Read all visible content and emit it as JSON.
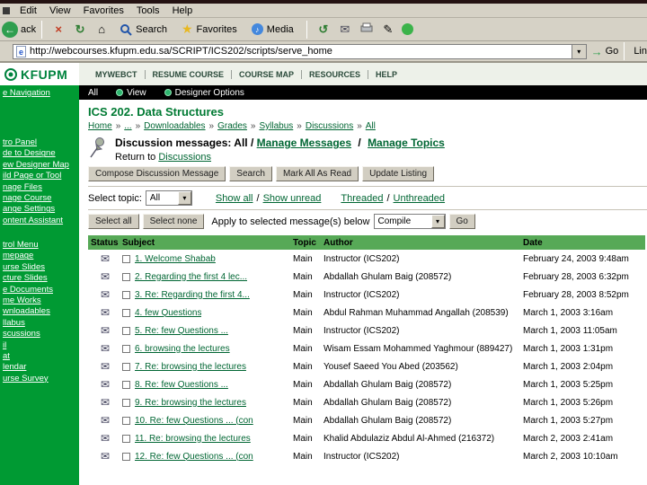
{
  "icons": {
    "back_arrow": "←",
    "stop": "×",
    "refresh": "↻",
    "home": "⌂",
    "star": "★",
    "note": "♪",
    "history": "↺",
    "mail": "✉",
    "edit": "✎",
    "dropdown": "▾",
    "envelope": "✉",
    "go_arrow": "→",
    "page": "e"
  },
  "window": {
    "menu": [
      "Edit",
      "View",
      "Favorites",
      "Tools",
      "Help"
    ],
    "toolbar": {
      "back_label": "ack",
      "search_label": "Search",
      "favorites_label": "Favorites",
      "media_label": "Media"
    },
    "address": {
      "url": "http://webcourses.kfupm.edu.sa/SCRIPT/ICS202/scripts/serve_home",
      "go_label": "Go",
      "links_label": "Lin"
    }
  },
  "header": {
    "logo": "KFUPM",
    "nav": [
      "MYWEBCT",
      "RESUME COURSE",
      "COURSE MAP",
      "RESOURCES",
      "HELP"
    ],
    "bar": {
      "filter": "All",
      "view": "View",
      "designer_options": "Designer Options"
    }
  },
  "sidebar": {
    "hide_navigation": "e Navigation",
    "group1": [
      "tro Panel",
      "de to Designe",
      "ew Designer Map",
      "ild Page or Tool",
      "nage Files",
      "nage Course",
      "ange Settings",
      "ontent Assistant"
    ],
    "group2": [
      "trol Menu",
      "mepage",
      "urse Slides",
      "cture Slides",
      "e Documents",
      "me Works",
      "wnloadables",
      "llabus",
      "scussions",
      "il",
      "at",
      "lendar",
      "urse Survey"
    ]
  },
  "content": {
    "course_title": "ICS 202. Data Structures",
    "breadcrumb": [
      "Home",
      "...",
      "Downloadables",
      "Grades",
      "Syllabus",
      "Discussions",
      "All"
    ],
    "title_prefix": "Discussion messages: All /",
    "manage_messages": "Manage Messages",
    "manage_topics": "Manage Topics",
    "return_prefix": "Return to",
    "return_link": "Discussions",
    "action_buttons": [
      "Compose Discussion Message",
      "Search",
      "Mark All As Read",
      "Update Listing"
    ],
    "topic_label": "Select topic:",
    "topic_value": "All",
    "show_all": "Show all",
    "show_unread": "Show unread",
    "threaded": "Threaded",
    "unthreaded": "Unthreaded",
    "slash": "/",
    "select_all": "Select all",
    "select_none": "Select none",
    "apply_label": "Apply to selected message(s) below",
    "compile_value": "Compile",
    "go_label": "Go"
  },
  "table": {
    "headers": [
      "Status",
      "Subject",
      "Topic",
      "Author",
      "Date"
    ],
    "rows": [
      {
        "subject": "1. Welcome Shabab",
        "topic": "Main",
        "author": "Instructor (ICS202)",
        "date": "February 24, 2003 9:48am"
      },
      {
        "subject": "2. Regarding the first 4 lec...",
        "topic": "Main",
        "author": "Abdallah Ghulam Baig (208572)",
        "date": "February 28, 2003 6:32pm"
      },
      {
        "subject": "3. Re: Regarding the first 4...",
        "topic": "Main",
        "author": "Instructor (ICS202)",
        "date": "February 28, 2003 8:52pm"
      },
      {
        "subject": "4. few Questions",
        "topic": "Main",
        "author": "Abdul Rahman Muhammad Angallah (208539)",
        "date": "March 1, 2003 3:16am"
      },
      {
        "subject": "5. Re: few Questions ...",
        "topic": "Main",
        "author": "Instructor (ICS202)",
        "date": "March 1, 2003 11:05am"
      },
      {
        "subject": "6. browsing the lectures",
        "topic": "Main",
        "author": "Wisam Essam Mohammed Yaghmour (889427)",
        "date": "March 1, 2003 1:31pm"
      },
      {
        "subject": "7. Re: browsing the lectures",
        "topic": "Main",
        "author": "Yousef Saeed You Abed (203562)",
        "date": "March 1, 2003 2:04pm"
      },
      {
        "subject": "8. Re: few Questions ...",
        "topic": "Main",
        "author": "Abdallah Ghulam Baig (208572)",
        "date": "March 1, 2003 5:25pm"
      },
      {
        "subject": "9. Re: browsing the lectures",
        "topic": "Main",
        "author": "Abdallah Ghulam Baig (208572)",
        "date": "March 1, 2003 5:26pm"
      },
      {
        "subject": "10. Re: few Questions ... (con",
        "topic": "Main",
        "author": "Abdallah Ghulam Baig (208572)",
        "date": "March 1, 2003 5:27pm"
      },
      {
        "subject": "11. Re: browsing the lectures",
        "topic": "Main",
        "author": "Khalid Abdulaziz Abdul Al-Ahmed (216372)",
        "date": "March 2, 2003 2:41am"
      },
      {
        "subject": "12. Re: few Questions ... (con",
        "topic": "Main",
        "author": "Instructor (ICS202)",
        "date": "March 2, 2003 10:10am"
      }
    ]
  }
}
